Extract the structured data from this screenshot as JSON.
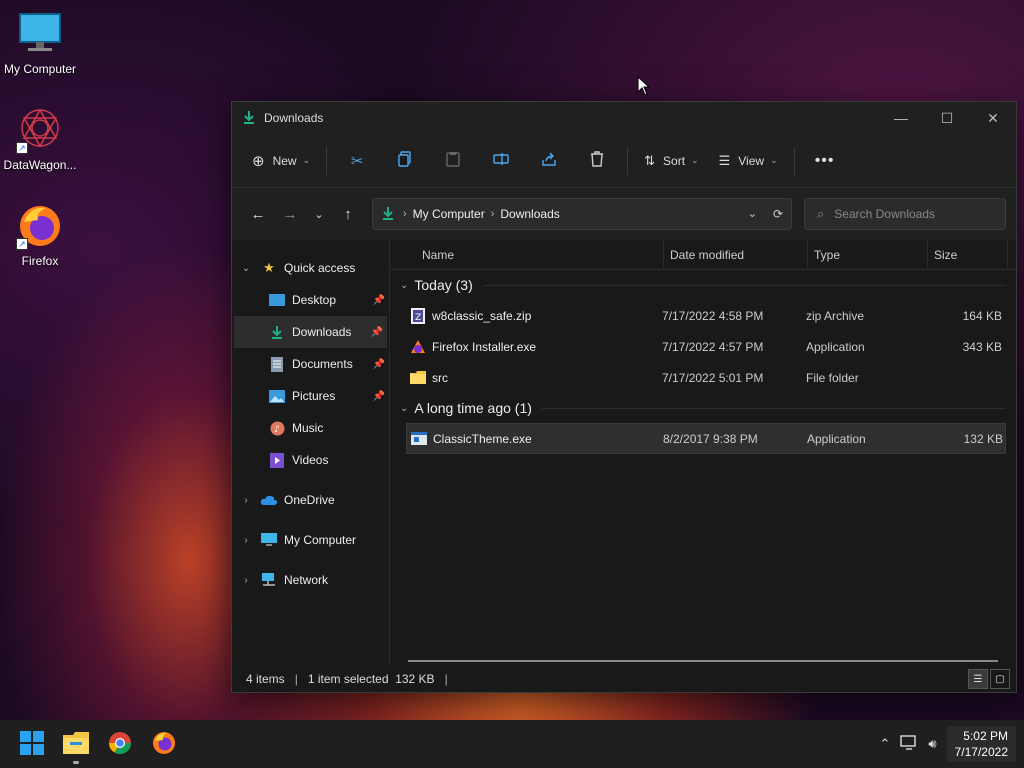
{
  "desktop": {
    "icons": [
      {
        "label": "My Computer"
      },
      {
        "label": "DataWagon..."
      },
      {
        "label": "Firefox"
      }
    ]
  },
  "window": {
    "title": "Downloads",
    "toolbar": {
      "new_label": "New",
      "sort_label": "Sort",
      "view_label": "View"
    },
    "address": {
      "crumbs": [
        "My Computer",
        "Downloads"
      ]
    },
    "search": {
      "placeholder": "Search Downloads"
    },
    "nav": {
      "quick_access": "Quick access",
      "items": [
        {
          "label": "Desktop"
        },
        {
          "label": "Downloads"
        },
        {
          "label": "Documents"
        },
        {
          "label": "Pictures"
        },
        {
          "label": "Music"
        },
        {
          "label": "Videos"
        }
      ],
      "roots": [
        {
          "label": "OneDrive"
        },
        {
          "label": "My Computer"
        },
        {
          "label": "Network"
        }
      ]
    },
    "columns": {
      "name": "Name",
      "date": "Date modified",
      "type": "Type",
      "size": "Size"
    },
    "groups": [
      {
        "label": "Today (3)",
        "files": [
          {
            "name": "w8classic_safe.zip",
            "date": "7/17/2022 4:58 PM",
            "type": "zip Archive",
            "size": "164 KB"
          },
          {
            "name": "Firefox Installer.exe",
            "date": "7/17/2022 4:57 PM",
            "type": "Application",
            "size": "343 KB"
          },
          {
            "name": "src",
            "date": "7/17/2022 5:01 PM",
            "type": "File folder",
            "size": ""
          }
        ]
      },
      {
        "label": "A long time ago (1)",
        "files": [
          {
            "name": "ClassicTheme.exe",
            "date": "8/2/2017 9:38 PM",
            "type": "Application",
            "size": "132 KB"
          }
        ]
      }
    ],
    "status": {
      "items": "4 items",
      "selected": "1 item selected  132 KB"
    }
  },
  "taskbar": {
    "time": "5:02 PM",
    "date": "7/17/2022"
  },
  "colors": {
    "accent": "#1db38a",
    "folder": "#f4c542",
    "window_bg": "#191919"
  }
}
